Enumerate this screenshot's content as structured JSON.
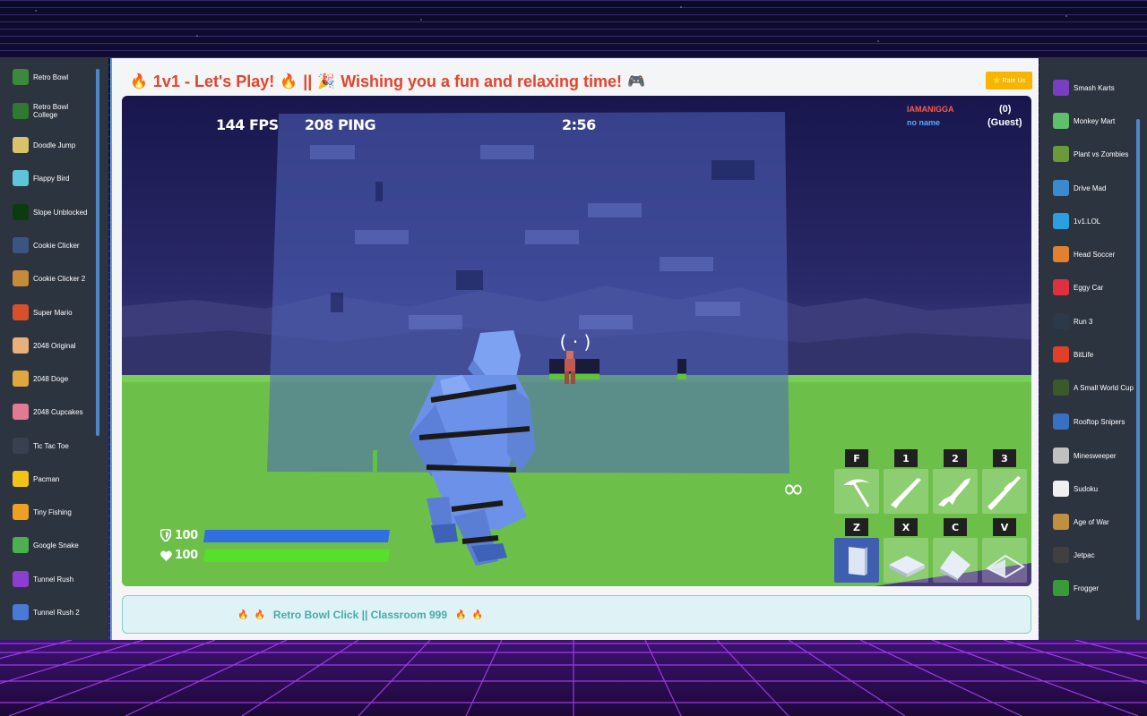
{
  "left_sidebar": {
    "items": [
      {
        "label": "Retro Bowl",
        "icon": "retro-bowl-icon",
        "color": "#3b8a3b"
      },
      {
        "label": "Retro Bowl College",
        "icon": "retro-bowl-college-icon",
        "color": "#2f7a2f"
      },
      {
        "label": "Doodle Jump",
        "icon": "doodle-jump-icon",
        "color": "#d9c36a"
      },
      {
        "label": "Flappy Bird",
        "icon": "flappy-bird-icon",
        "color": "#5fc4d8"
      },
      {
        "label": "Slope Unblocked",
        "icon": "slope-icon",
        "color": "#0d3b10"
      },
      {
        "label": "Cookie Clicker",
        "icon": "cookie-clicker-icon",
        "color": "#3a5680"
      },
      {
        "label": "Cookie Clicker 2",
        "icon": "cookie-clicker-2-icon",
        "color": "#c68b3a"
      },
      {
        "label": "Super Mario",
        "icon": "super-mario-icon",
        "color": "#d8502a"
      },
      {
        "label": "2048 Original",
        "icon": "2048-original-icon",
        "color": "#e8b07a"
      },
      {
        "label": "2048 Doge",
        "icon": "2048-doge-icon",
        "color": "#e0a640"
      },
      {
        "label": "2048 Cupcakes",
        "icon": "2048-cupcakes-icon",
        "color": "#e07b93"
      },
      {
        "label": "Tic Tac Toe",
        "icon": "tic-tac-toe-icon",
        "color": "#394050"
      },
      {
        "label": "Pacman",
        "icon": "pacman-icon",
        "color": "#f2c418"
      },
      {
        "label": "Tiny Fishing",
        "icon": "tiny-fishing-icon",
        "color": "#f0a020"
      },
      {
        "label": "Google Snake",
        "icon": "google-snake-icon",
        "color": "#4caf50"
      },
      {
        "label": "Tunnel Rush",
        "icon": "tunnel-rush-icon",
        "color": "#8b3fd0"
      },
      {
        "label": "Tunnel Rush 2",
        "icon": "tunnel-rush-2-icon",
        "color": "#4a7ad8"
      }
    ]
  },
  "right_sidebar": {
    "items": [
      {
        "label": "Smash Karts",
        "icon": "smash-karts-icon",
        "color": "#7a3fc0"
      },
      {
        "label": "Monkey Mart",
        "icon": "monkey-mart-icon",
        "color": "#5fbf6a"
      },
      {
        "label": "Plant vs Zombies",
        "icon": "plant-vs-zombies-icon",
        "color": "#6a9a3a"
      },
      {
        "label": "Drive Mad",
        "icon": "drive-mad-icon",
        "color": "#3a8ad0"
      },
      {
        "label": "1v1.LOL",
        "icon": "1v1-lol-icon",
        "color": "#2aa0e0"
      },
      {
        "label": "Head Soccer",
        "icon": "head-soccer-icon",
        "color": "#e08030"
      },
      {
        "label": "Eggy Car",
        "icon": "eggy-car-icon",
        "color": "#e03040"
      },
      {
        "label": "Run 3",
        "icon": "run-3-icon",
        "color": "#2a3a4a"
      },
      {
        "label": "BitLife",
        "icon": "bitlife-icon",
        "color": "#e04028"
      },
      {
        "label": "A Small World Cup",
        "icon": "small-world-cup-icon",
        "color": "#3a5a2a"
      },
      {
        "label": "Rooftop Snipers",
        "icon": "rooftop-snipers-icon",
        "color": "#3a70c0"
      },
      {
        "label": "Minesweeper",
        "icon": "minesweeper-icon",
        "color": "#c0c0c0"
      },
      {
        "label": "Sudoku",
        "icon": "sudoku-icon",
        "color": "#f0f0f0"
      },
      {
        "label": "Age of War",
        "icon": "age-of-war-icon",
        "color": "#c09040"
      },
      {
        "label": "Jetpac",
        "icon": "jetpac-icon",
        "color": "#404040"
      },
      {
        "label": "Frogger",
        "icon": "frogger-icon",
        "color": "#3a9a3a"
      }
    ]
  },
  "header": {
    "title_part1": "1v1 - Let's Play!",
    "separator": "||",
    "title_part2": "Wishing you a fun and relaxing time!",
    "rate_button": "⭐ Rate Us"
  },
  "game": {
    "fps": "144 FPS",
    "ping": "208 PING",
    "timer": "2:56",
    "player1_name": "IAMANIGGA",
    "player2_name": "no name",
    "player1_score": "(0)",
    "player2_score": "(Guest)",
    "shield": "100",
    "health": "100",
    "ammo": "∞",
    "weapon_keys": [
      "F",
      "1",
      "2",
      "3"
    ],
    "build_keys": [
      "Z",
      "X",
      "C",
      "V"
    ],
    "crosshair": "( · )",
    "colors": {
      "player1": "#ff5a4a",
      "player2": "#5aa8ff",
      "shield_bar": "#2f6fe0",
      "health_bar": "#56e02a",
      "grass": "#6cc04a"
    }
  },
  "footer": {
    "text": "Retro Bowl Click || Classroom 999"
  }
}
